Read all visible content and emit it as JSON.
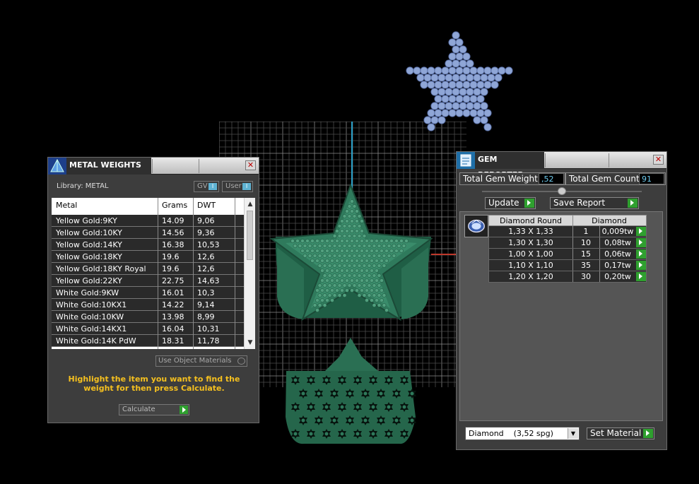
{
  "metal_weights": {
    "title": "METAL WEIGHTS",
    "library_label": "Library: METAL",
    "gv_label": "GV",
    "user_label": "User",
    "columns": [
      "Metal",
      "Grams",
      "DWT"
    ],
    "rows": [
      [
        "Yellow Gold:9KY",
        "14.09",
        "9,06"
      ],
      [
        "Yellow Gold:10KY",
        "14.56",
        "9,36"
      ],
      [
        "Yellow Gold:14KY",
        "16.38",
        "10,53"
      ],
      [
        "Yellow Gold:18KY",
        "19.6",
        "12,6"
      ],
      [
        "Yellow Gold:18KY Royal",
        "19.6",
        "12,6"
      ],
      [
        "Yellow Gold:22KY",
        "22.75",
        "14,63"
      ],
      [
        "White Gold:9KW",
        "16.01",
        "10,3"
      ],
      [
        "White Gold:10KX1",
        "14.22",
        "9,14"
      ],
      [
        "White Gold:10KW",
        "13.98",
        "8,99"
      ],
      [
        "White Gold:14KX1",
        "16.04",
        "10,31"
      ],
      [
        "White Gold:14K PdW",
        "18.31",
        "11,78"
      ]
    ],
    "use_object_materials": "Use Object Materials",
    "hint": "Highlight the item you want to find the weight for then press Calculate.",
    "calculate_label": "Calculate"
  },
  "gem_reporter": {
    "title": "GEM REPORTER",
    "total_weight_label": "Total Gem Weight",
    "total_weight_value": ",52",
    "total_count_label": "Total Gem Count",
    "total_count_value": "91",
    "update_label": "Update",
    "save_report_label": "Save Report",
    "columns": [
      "Diamond Round",
      "Diamond"
    ],
    "rows": [
      [
        "1,33 X 1,33",
        "1",
        "0,009tw"
      ],
      [
        "1,30 X 1,30",
        "10",
        "0,08tw"
      ],
      [
        "1,00 X 1,00",
        "15",
        "0,06tw"
      ],
      [
        "1,10 X 1,10",
        "35",
        "0,17tw"
      ],
      [
        "1,20 X 1,20",
        "30",
        "0,20tw"
      ]
    ],
    "material_select": "Diamond    (3,52 spg)",
    "set_material_label": "Set Material"
  },
  "colors": {
    "model_green": "#2f7a5c",
    "gem_blue": "#8fa6d6",
    "hint_yellow": "#f5c01f",
    "value_blue": "#6ecbee",
    "go_green": "#2fa02f"
  }
}
